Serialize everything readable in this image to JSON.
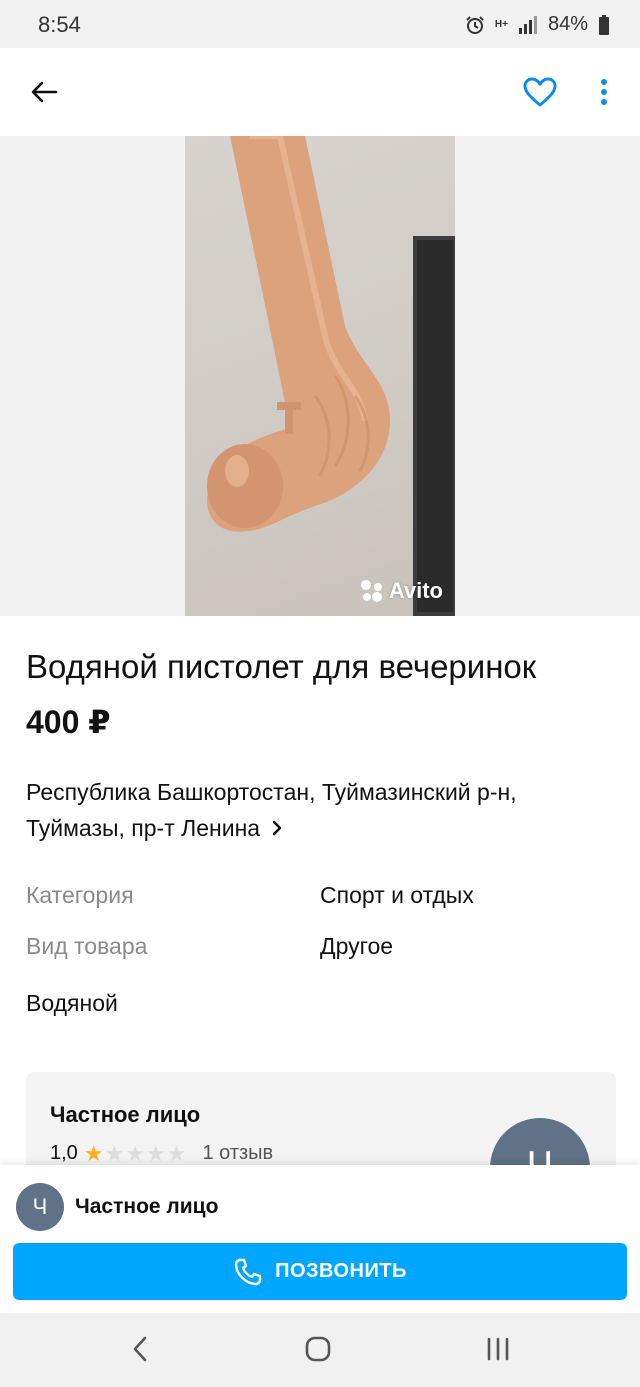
{
  "status_bar": {
    "time": "8:54",
    "battery": "84%",
    "network": "H+"
  },
  "listing": {
    "title": "Водяной пистолет для вечеринок",
    "price": "400 ₽",
    "address": "Республика Башкортостан, Туймазинский р-н, Туймазы, пр-т Ленина",
    "params": [
      {
        "label": "Категория",
        "value": "Спорт и отдых"
      },
      {
        "label": "Вид товара",
        "value": "Другое"
      }
    ],
    "description": "Водяной",
    "photo_watermark": "Avito"
  },
  "seller": {
    "name": "Частное лицо",
    "rating": "1,0",
    "stars": 1,
    "stars_total": 5,
    "reviews": "1 отзыв",
    "avatar_letter": "Ч"
  },
  "bottom_sheet": {
    "seller_name": "Частное лицо",
    "avatar_letter": "Ч",
    "call_label": "ПОЗВОНИТЬ"
  },
  "colors": {
    "accent": "#00a6ff",
    "favorite": "#0a8bf0",
    "star": "#ffb021",
    "avatar": "#5f7287"
  },
  "icons": [
    "back-arrow-icon",
    "heart-icon",
    "more-vertical-icon",
    "phone-icon",
    "chevron-right-icon",
    "alarm-icon",
    "signal-icon",
    "battery-icon",
    "nav-back-icon",
    "nav-home-icon",
    "nav-recents-icon"
  ]
}
